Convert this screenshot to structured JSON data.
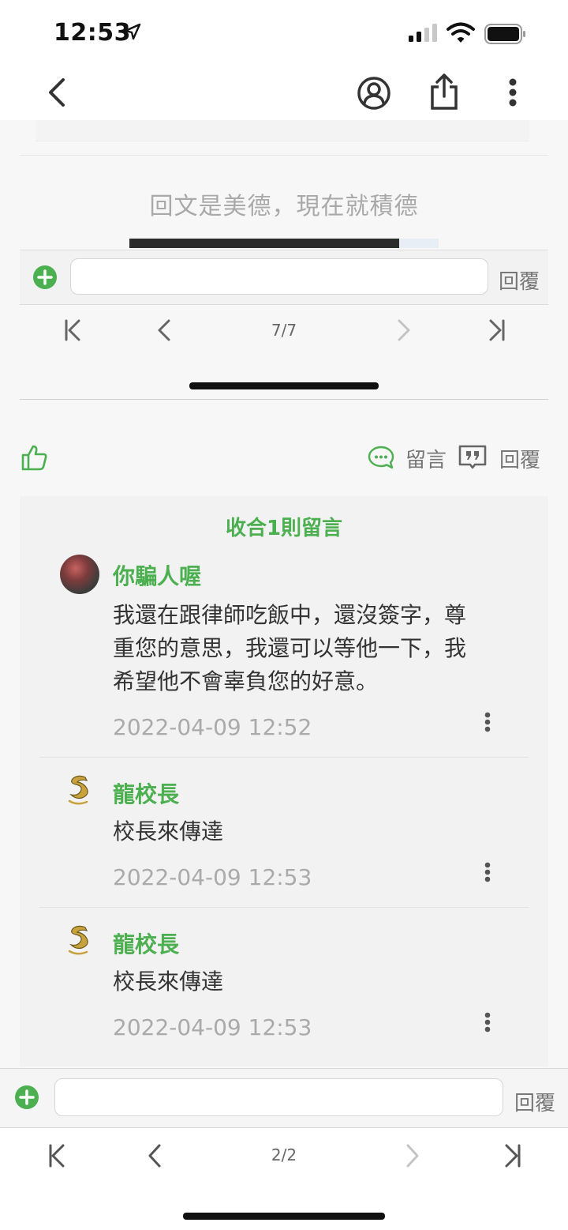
{
  "status_bar": {
    "time": "12:53"
  },
  "embedded": {
    "slogan": "回文是美德，現在就積德",
    "reply_label": "回覆",
    "pager": {
      "page": "7/7"
    }
  },
  "actions": {
    "comment_label": "留言",
    "reply_label": "回覆"
  },
  "comments": {
    "collapse_label": "收合1則留言",
    "items": [
      {
        "name": "你騙人喔",
        "text_lines": [
          "我還在跟律師吃飯中，還沒簽字，尊",
          "重您的意思，我還可以等他一下，我",
          "希望他不會辜負您的好意。"
        ],
        "date": "2022-04-09 12:52"
      },
      {
        "name": "龍校長",
        "text_lines": [
          "校長來傳達"
        ],
        "date": "2022-04-09 12:53"
      },
      {
        "name": "龍校長",
        "text_lines": [
          "校長來傳達"
        ],
        "date": "2022-04-09 12:53"
      }
    ]
  },
  "bottom": {
    "reply_label": "回覆",
    "page": "2/2"
  },
  "colors": {
    "accent": "#4caf50",
    "muted": "#aaaaaa"
  }
}
